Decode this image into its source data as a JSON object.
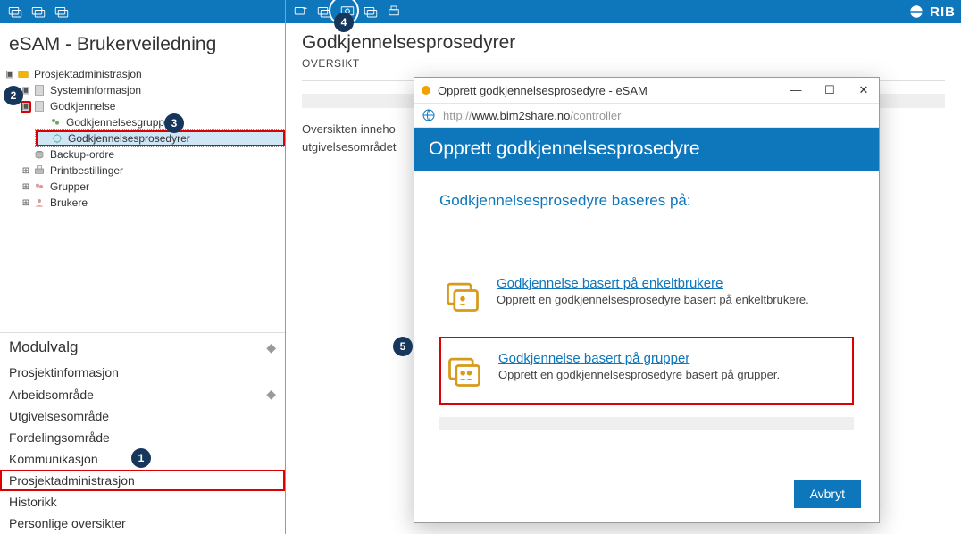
{
  "brand": "RIB",
  "left": {
    "title": "eSAM - Brukerveiledning",
    "root": "Prosjektadministrasjon",
    "systeminfo": "Systeminformasjon",
    "godkjennelse": "Godkjennelse",
    "godkjennelsesgrupper": "Godkjennelsesgrupper",
    "godkjennelsesprosedyrer": "Godkjennelsesprosedyrer",
    "backup": "Backup-ordre",
    "print": "Printbestillinger",
    "grupper": "Grupper",
    "brukere": "Brukere",
    "modulvalg": "Modulvalg",
    "modules": {
      "prosjektinfo": "Prosjektinformasjon",
      "arbeidsomrade": "Arbeidsområde",
      "utgivelsesomrade": "Utgivelsesområde",
      "fordelingsomrade": "Fordelingsområde",
      "kommunikasjon": "Kommunikasjon",
      "prosjektadmin": "Prosjektadministrasjon",
      "historikk": "Historikk",
      "personlige": "Personlige oversikter"
    }
  },
  "right": {
    "title": "Godkjennelsesprosedyrer",
    "subtitle": "OVERSIKT",
    "body_prefix": "Oversikten inneho",
    "body_suffix": "nter til utgivelsesområdet"
  },
  "dialog": {
    "window_title": "Opprett godkjennelsesprosedyre - eSAM",
    "url_grey1": "http://",
    "url_main": "www.bim2share.no",
    "url_grey2": "/controller",
    "heading": "Opprett godkjennelsesprosedyre",
    "subheading": "Godkjennelsesprosedyre baseres på:",
    "opt1_title": "Godkjennelse basert på enkeltbrukere",
    "opt1_desc": "Opprett en godkjennelsesprosedyre basert på enkeltbrukere.",
    "opt2_title": "Godkjennelse basert på grupper",
    "opt2_desc": "Opprett en godkjennelsesprosedyre basert på grupper.",
    "cancel": "Avbryt"
  },
  "badges": {
    "b1": "1",
    "b2": "2",
    "b3": "3",
    "b4": "4",
    "b5": "5"
  }
}
